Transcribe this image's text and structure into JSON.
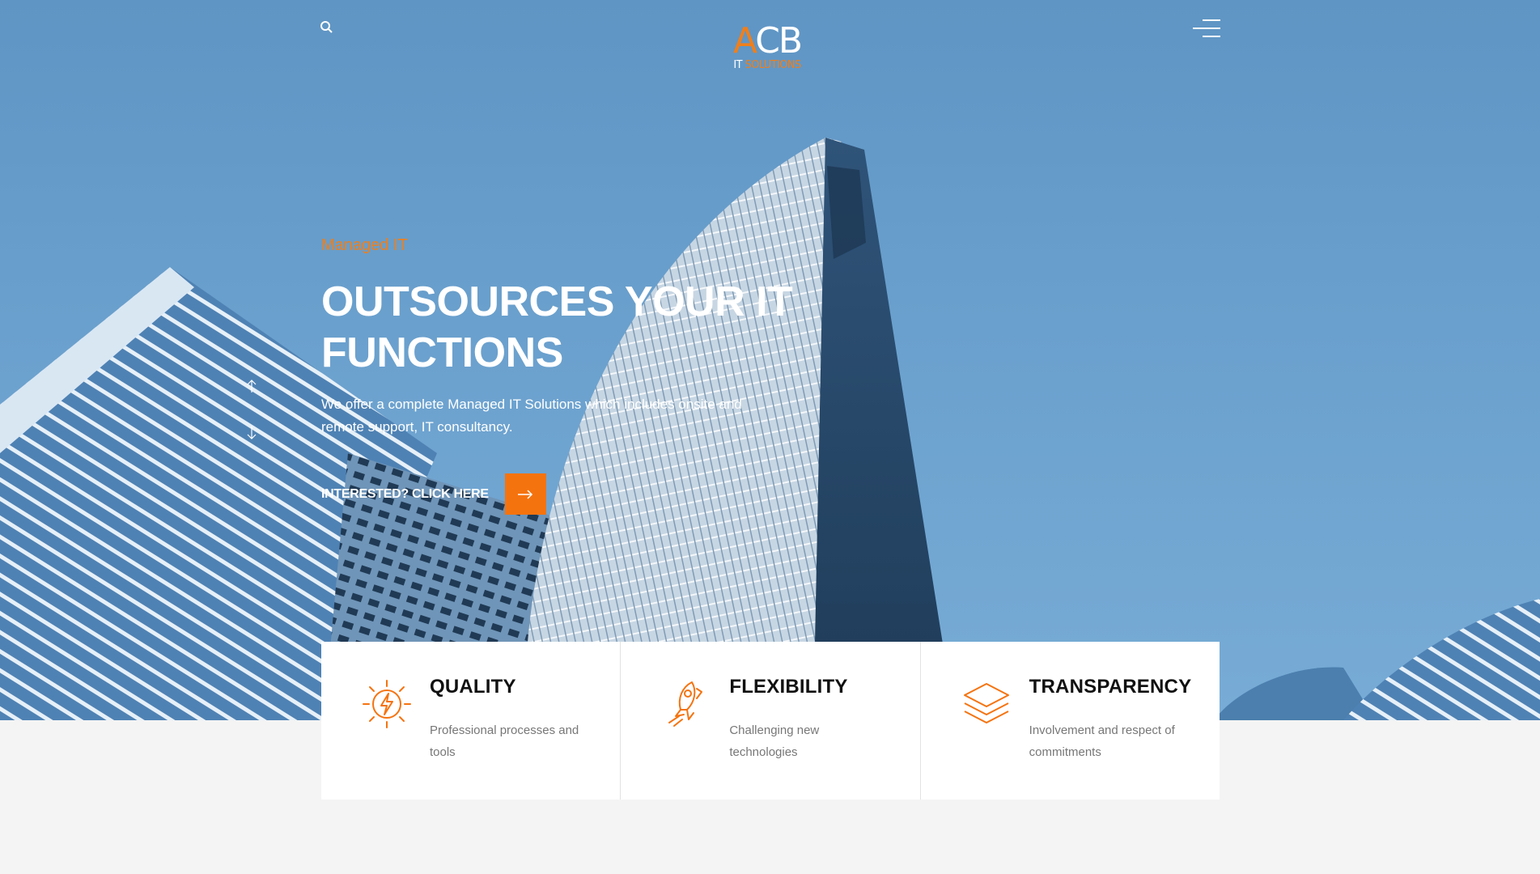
{
  "header": {
    "search_icon": "search-icon",
    "logo": {
      "letter_a": "A",
      "letters_cb": "CB",
      "sub_it": "IT",
      "sub_solutions": "SOLUTIONS"
    },
    "menu_icon": "hamburger-menu-icon"
  },
  "hero": {
    "eyebrow": "Managed IT",
    "headline": "OUTSOURCES YOUR IT FUNCTIONS",
    "description": "We offer a complete Managed IT Solutions which includes onsite and remote support, IT consultancy.",
    "cta_label": "INTERESTED? CLICK HERE",
    "cta_icon": "arrow-right-icon",
    "slider_up_icon": "arrow-up-icon",
    "slider_down_icon": "arrow-down-icon"
  },
  "features": [
    {
      "icon": "sun-bolt-icon",
      "title": "QUALITY",
      "description": "Professional processes and tools"
    },
    {
      "icon": "rocket-runner-icon",
      "title": "FLEXIBILITY",
      "description": "Challenging new technologies"
    },
    {
      "icon": "layers-icon",
      "title": "TRANSPARENCY",
      "description": "Involvement and respect of commitments"
    }
  ],
  "colors": {
    "accent": "#f5730f",
    "sky": "#6aa0cd",
    "card_bg": "#ffffff",
    "page_bg": "#f4f4f4"
  }
}
